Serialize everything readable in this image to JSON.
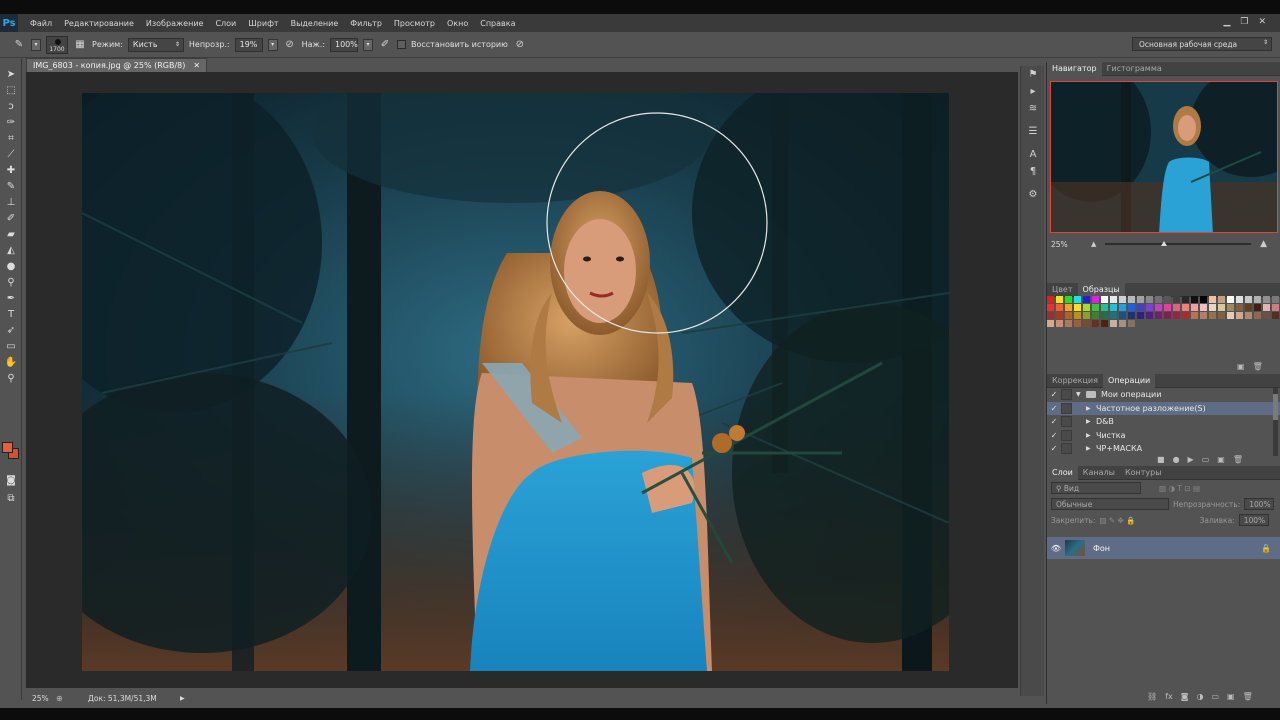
{
  "menu": {
    "logo": "Ps",
    "items": [
      "Файл",
      "Редактирование",
      "Изображение",
      "Слои",
      "Шрифт",
      "Выделение",
      "Фильтр",
      "Просмотр",
      "Окно",
      "Справка"
    ]
  },
  "options": {
    "brush_size": "1700",
    "mode_label": "Режим:",
    "mode_value": "Кисть",
    "opacity_label": "Непрозр.:",
    "opacity_value": "19%",
    "pressure_label": "Наж.:",
    "pressure_value": "100%",
    "restore_history": "Восстановить историю",
    "workspace": "Основная рабочая среда"
  },
  "document": {
    "tab_title": "IMG_6803 - копия.jpg @ 25% (RGB/8)",
    "zoom": "25%",
    "doc_info": "Док: 51,3M/51,3M"
  },
  "navigator": {
    "tabs": [
      "Навигатор",
      "Гистограмма"
    ],
    "zoom": "25%"
  },
  "swatches": {
    "tabs": [
      "Цвет",
      "Образцы"
    ],
    "colors": [
      "#e02020",
      "#f0e020",
      "#20e020",
      "#20e0e0",
      "#2020e0",
      "#e020e0",
      "#ffffff",
      "#e8e8e8",
      "#d0d0d0",
      "#b8b8b8",
      "#a0a0a0",
      "#888888",
      "#707070",
      "#585858",
      "#404040",
      "#282828",
      "#101010",
      "#000000",
      "#f0c0a0",
      "#c0a080",
      "#f8f8f8",
      "#e0e0e0",
      "#c8c8c8",
      "#b0b0b0",
      "#909090",
      "#787878",
      "#606060",
      "#484848",
      "#e83030",
      "#f06030",
      "#f8a020",
      "#f8e020",
      "#a0e020",
      "#40c040",
      "#20c090",
      "#20c0d0",
      "#20a0e0",
      "#2060e0",
      "#4040d0",
      "#8040d0",
      "#c040c0",
      "#e040a0",
      "#e06080",
      "#f08080",
      "#f0a0a0",
      "#f0c0c0",
      "#e8d8c0",
      "#d8c8a0",
      "#a08860",
      "#806040",
      "#604020",
      "#402010",
      "#e8b0b0",
      "#c88080",
      "#a86060",
      "#884040",
      "#983030",
      "#a83820",
      "#b86020",
      "#b89020",
      "#90a020",
      "#408030",
      "#207050",
      "#207080",
      "#205080",
      "#203070",
      "#302080",
      "#502080",
      "#702070",
      "#802050",
      "#a02040",
      "#a03030",
      "#c07050",
      "#b08060",
      "#987050",
      "#806040",
      "#e8c8b8",
      "#d0a890",
      "#b08870",
      "#906850",
      "#705040",
      "#503020",
      "#f0d8c8",
      "#e8c0a8",
      "#d8a888",
      "#c89070",
      "#b07858",
      "#986040",
      "#804830",
      "#683020",
      "#502010",
      "#c8b0a0",
      "#a89080",
      "#887060"
    ]
  },
  "actions": {
    "tabs": [
      "Коррекция",
      "Операции"
    ],
    "folder": "Мои операции",
    "items": [
      "Частотное разложение(S)",
      "D&B",
      "Чистка",
      "ЧР+МАСКА"
    ]
  },
  "layers": {
    "tabs": [
      "Слои",
      "Каналы",
      "Контуры"
    ],
    "kind": "Вид",
    "blend": "Обычные",
    "opacity_label": "Непрозрачность:",
    "opacity_value": "100%",
    "lock_label": "Закрепить:",
    "fill_label": "Заливка:",
    "fill_value": "100%",
    "layer_name": "Фон"
  },
  "colors": {
    "foreground": "#e85f3e",
    "background": "#d0522f",
    "selection": "#5e6c86",
    "nav_frame": "#e0443a"
  }
}
